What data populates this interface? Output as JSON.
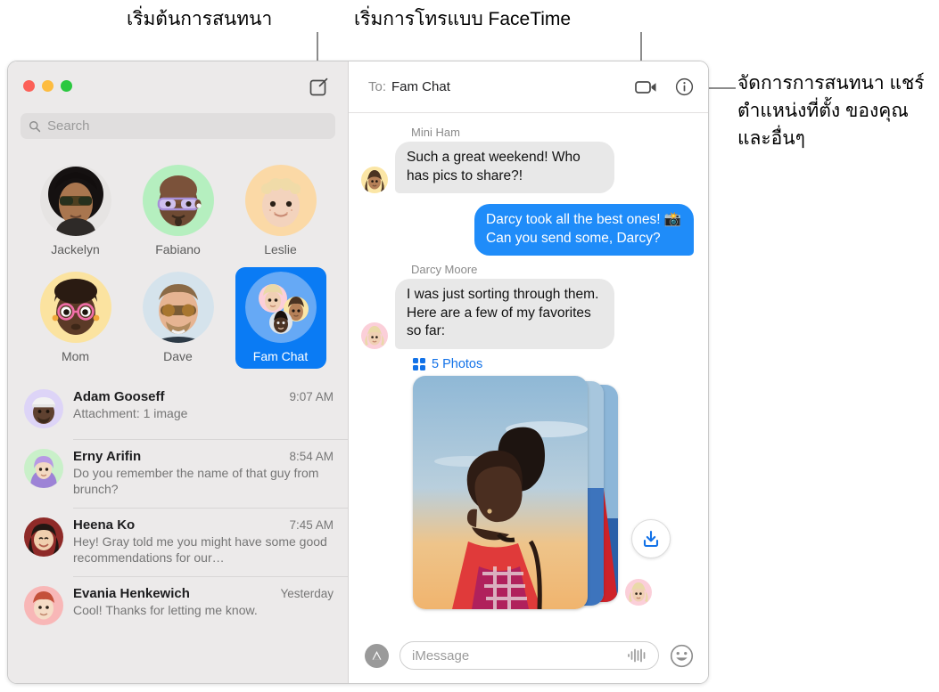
{
  "annotations": [
    {
      "id": "compose",
      "text": "เริ่มต้นการสนทนา"
    },
    {
      "id": "facetime",
      "text": "เริ่มการโทรแบบ FaceTime"
    },
    {
      "id": "manage",
      "text": "จัดการการสนทนา แชร์ตำแหน่งที่ตั้ง ของคุณ และอื่นๆ"
    }
  ],
  "window": {
    "traffic_lights": [
      "close",
      "minimize",
      "zoom"
    ],
    "compose_icon": "compose-pencil-icon"
  },
  "sidebar": {
    "search": {
      "placeholder": "Search",
      "icon": "search-icon"
    },
    "pinned": [
      {
        "name": "Jackelyn",
        "selected": false
      },
      {
        "name": "Fabiano",
        "selected": false
      },
      {
        "name": "Leslie",
        "selected": false
      },
      {
        "name": "Mom",
        "selected": false
      },
      {
        "name": "Dave",
        "selected": false
      },
      {
        "name": "Fam Chat",
        "selected": true
      }
    ],
    "conversations": [
      {
        "name": "Adam Gooseff",
        "time": "9:07 AM",
        "preview": "Attachment: 1 image"
      },
      {
        "name": "Erny Arifin",
        "time": "8:54 AM",
        "preview": "Do you remember the name of that guy from brunch?"
      },
      {
        "name": "Heena Ko",
        "time": "7:45 AM",
        "preview": "Hey! Gray told me you might have some good recommendations for our…"
      },
      {
        "name": "Evania Henkewich",
        "time": "Yesterday",
        "preview": "Cool! Thanks for letting me know."
      }
    ]
  },
  "thread": {
    "to_label": "To:",
    "to_value": "Fam Chat",
    "facetime_icon": "video-camera-icon",
    "info_icon": "info-circle-icon",
    "messages": [
      {
        "sender": "Mini Ham",
        "direction": "in",
        "text": "Such a great weekend! Who has pics to share?!"
      },
      {
        "sender": "",
        "direction": "out",
        "text": "Darcy took all the best ones! 📸 Can you send some, Darcy?"
      },
      {
        "sender": "Darcy Moore",
        "direction": "in",
        "text": "I was just sorting through them. Here are a few of my favorites so far:"
      }
    ],
    "attachment": {
      "icon": "photo-grid-icon",
      "label": "5 Photos",
      "download_icon": "download-icon"
    }
  },
  "composer": {
    "apps_icon": "app-store-icon",
    "placeholder": "iMessage",
    "audio_icon": "audio-waveform-icon",
    "emoji_icon": "smiley-face-icon"
  },
  "colors": {
    "accent_blue": "#0a7bf4",
    "bubble_out": "#1f8cf9",
    "bubble_in": "#e8e8e8",
    "sidebar_bg": "#eceaea",
    "link_blue": "#1272e8"
  }
}
